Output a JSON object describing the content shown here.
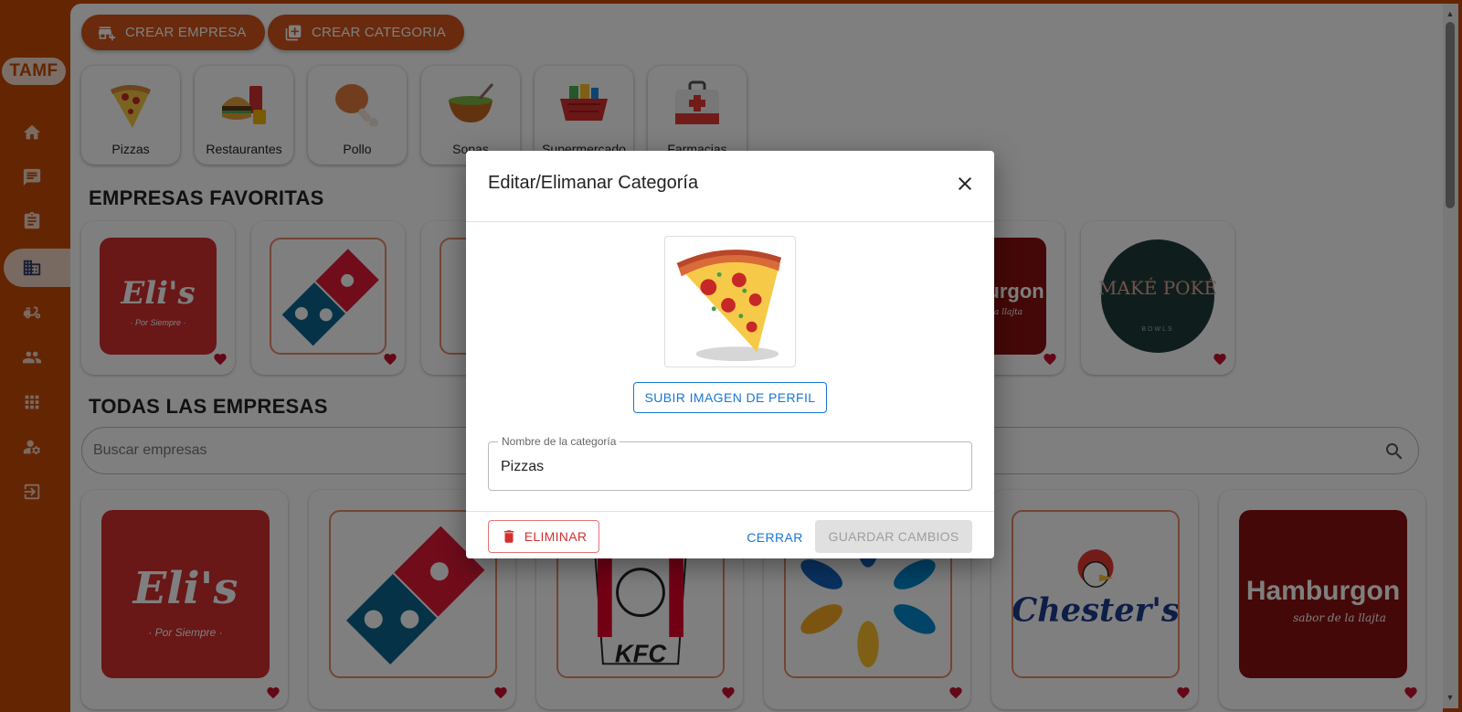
{
  "app": {
    "brand": "TAMF"
  },
  "sidebar": {
    "items": [
      {
        "icon": "home-icon"
      },
      {
        "icon": "chat-icon"
      },
      {
        "icon": "clipboard-icon"
      },
      {
        "icon": "building-icon",
        "active": true
      },
      {
        "icon": "delivery-icon"
      },
      {
        "icon": "users-icon"
      },
      {
        "icon": "apps-icon"
      },
      {
        "icon": "user-settings-icon"
      },
      {
        "icon": "logout-icon"
      }
    ]
  },
  "toolbar": {
    "create_company": "CREAR EMPRESA",
    "create_category": "CREAR CATEGORIA"
  },
  "categories": [
    {
      "label": "Pizzas"
    },
    {
      "label": "Restaurantes"
    },
    {
      "label": "Pollo"
    },
    {
      "label": "Sopas"
    },
    {
      "label": "Supermercado"
    },
    {
      "label": "Farmacias"
    }
  ],
  "favorites": {
    "title": "EMPRESAS FAVORITAS",
    "items": [
      {
        "logo": "Eli's",
        "sub": "· Por Siempre ·"
      },
      {
        "logo": "domino-logo"
      },
      {
        "logo": "hidden-logo"
      },
      {
        "logo": "hidden-logo"
      },
      {
        "logo": "hidden-logo"
      },
      {
        "logo": "Hamburgon",
        "sub": "sabor de la llajta"
      },
      {
        "logo": "MAKÉ POKÉ",
        "sub": "BOWLS"
      }
    ]
  },
  "all_companies": {
    "title": "TODAS LAS EMPRESAS",
    "search_placeholder": "Buscar empresas",
    "items": [
      {
        "logo": "Eli's",
        "sub": "· Por Siempre ·"
      },
      {
        "logo": "domino-logo"
      },
      {
        "logo": "KFC"
      },
      {
        "logo": "flower-logo"
      },
      {
        "logo": "Chester's"
      },
      {
        "logo": "Hamburgon",
        "sub": "sabor de la llajta"
      }
    ]
  },
  "modal": {
    "title": "Editar/Elimanar Categoría",
    "upload_label": "SUBIR IMAGEN DE PERFIL",
    "field_label": "Nombre de la categoría",
    "field_value": "Pizzas",
    "delete_label": "ELIMINAR",
    "close_label": "CERRAR",
    "save_label": "GUARDAR CAMBIOS"
  },
  "colors": {
    "brand": "#c94a07",
    "accent": "#d3541a",
    "link": "#1976d2",
    "danger": "#d32f2f",
    "heart": "#c8102e"
  }
}
